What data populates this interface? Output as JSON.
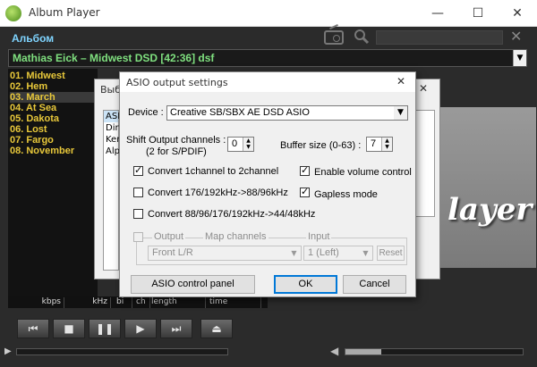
{
  "window": {
    "title": "Album Player",
    "minimize": "—",
    "maximize": "☐",
    "close": "✕"
  },
  "header": {
    "album_label": "Альбом",
    "close_search": "✕"
  },
  "now_playing": {
    "combo_text": "Mathias Eick – Midwest DSD  [42:36]  dsf",
    "arrow": "▼"
  },
  "playlist": {
    "items": [
      {
        "label": "01. Midwest"
      },
      {
        "label": "02. Hem"
      },
      {
        "label": "03. March"
      },
      {
        "label": "04. At Sea"
      },
      {
        "label": "05. Dakota"
      },
      {
        "label": "06. Lost"
      },
      {
        "label": "07. Fargo"
      },
      {
        "label": "08. November"
      }
    ],
    "selected_index": 2
  },
  "logo": {
    "text": "layer"
  },
  "columns": {
    "kbps": "kbps",
    "khz": "kHz",
    "bit": "bi",
    "ch": "ch",
    "length": "length",
    "time": "time"
  },
  "transport": {
    "prev": "⏮",
    "stop": "■",
    "pause": "❚❚",
    "play": "▶",
    "next": "⏭",
    "eject": "⏏"
  },
  "back_dialog": {
    "title": "Выб",
    "close": "✕",
    "list_items": [
      "ASI",
      "Dir",
      "Ker",
      "Alp"
    ]
  },
  "asio": {
    "title": "ASIO output settings",
    "close": "✕",
    "device_label": "Device :",
    "device_value": "Creative SB/SBX AE DSD ASIO",
    "shift_label_line1": "Shift Output channels :",
    "shift_label_line2": "(2 for S/PDIF)",
    "shift_value": "0",
    "buffer_label": "Buffer size (0-63) :",
    "buffer_value": "7",
    "checkboxes": {
      "convert1to2": {
        "label": "Convert 1channel to 2channel",
        "checked": true
      },
      "enable_volume": {
        "label": "Enable volume control",
        "checked": true
      },
      "convert176": {
        "label": "Convert 176/192kHz->88/96kHz",
        "checked": false
      },
      "gapless": {
        "label": "Gapless mode",
        "checked": true
      },
      "convert88": {
        "label": "Convert 88/96/176/192kHz->44/48kHz",
        "checked": false
      }
    },
    "map_group": {
      "output_label": "Output",
      "map_channels_label": "Map channels",
      "input_label": "Input",
      "output_value": "Front L/R",
      "input_value": "1 (Left)",
      "reset_label": "Reset"
    },
    "buttons": {
      "control_panel": "ASIO control panel",
      "ok": "OK",
      "cancel": "Cancel"
    }
  }
}
